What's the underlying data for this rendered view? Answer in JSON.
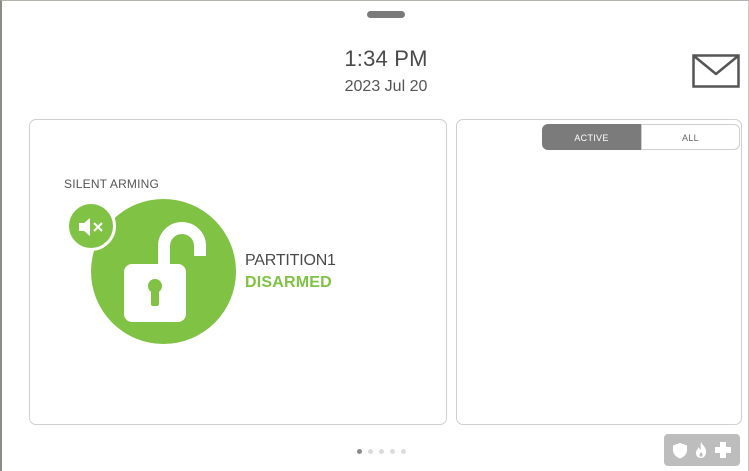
{
  "header": {
    "time": "1:34 PM",
    "date": "2023 Jul 20",
    "messages_icon": "envelope-icon"
  },
  "partition_panel": {
    "silent_arming_label": "SILENT ARMING",
    "mute_icon": "speaker-muted-icon",
    "lock_icon": "unlocked-padlock-icon",
    "partition_name": "PARTITION1",
    "status": "DISARMED",
    "status_color": "#7fc244"
  },
  "events_panel": {
    "filter_tabs": [
      {
        "label": "ACTIVE",
        "selected": true
      },
      {
        "label": "ALL",
        "selected": false
      }
    ]
  },
  "pager": {
    "page_count": 5,
    "current_page": 1
  },
  "emergency_button": {
    "icons": [
      "shield-icon",
      "flame-icon",
      "medical-cross-icon"
    ]
  },
  "colors": {
    "accent_green": "#7fc244",
    "segment_selected": "#7b7b7b",
    "emergency_bg": "#bdbdbd"
  }
}
